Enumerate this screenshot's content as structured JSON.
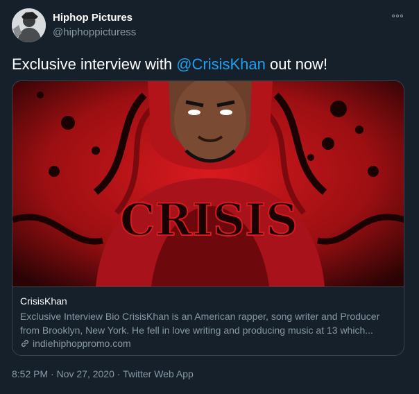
{
  "user": {
    "display_name": "Hiphop Pictures",
    "handle": "@hiphoppicturess",
    "avatar_icon": "avatar"
  },
  "tweet": {
    "text_before": "Exclusive interview with ",
    "mention": "@CrisisKhan",
    "text_after": " out now!"
  },
  "card": {
    "image_text": "CRISIS",
    "title": "CrisisKhan",
    "description": "Exclusive Interview Bio CrisisKhan is an American rapper, song writer and Producer from Brooklyn, New York. He fell in love writing and producing music at 13 which...",
    "domain": "indiehiphoppromo.com",
    "link_icon": "link-icon"
  },
  "footer": {
    "time": "8:52 PM",
    "separator1": " · ",
    "date": "Nov 27, 2020",
    "separator2": " · ",
    "source": "Twitter Web App"
  },
  "colors": {
    "background": "#15202b",
    "link": "#1da1f2",
    "secondary_text": "#8899a6",
    "border": "#38444d",
    "image_red": "#c8161b"
  }
}
